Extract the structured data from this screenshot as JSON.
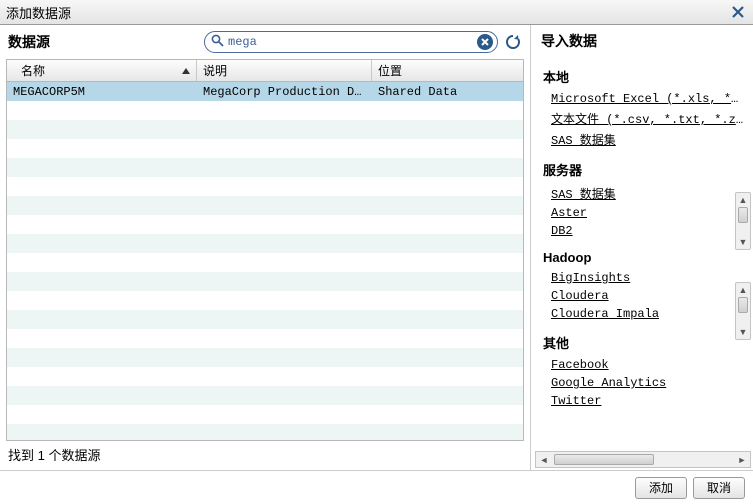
{
  "title": "添加数据源",
  "left": {
    "heading": "数据源",
    "search": {
      "value": "mega"
    },
    "columns": {
      "name": "名称",
      "desc": "说明",
      "loc": "位置"
    },
    "rows": [
      {
        "name": "MEGACORP5M",
        "desc": "MegaCorp Production Dat...",
        "loc": "Shared Data"
      }
    ],
    "footer": "找到 1 个数据源"
  },
  "right": {
    "heading": "导入数据",
    "sections": [
      {
        "title": "本地",
        "items": [
          "Microsoft Excel (*.xls, *.xlsx, *.",
          "文本文件 (*.csv, *.txt, *.zip)",
          "SAS 数据集"
        ],
        "scroll": false
      },
      {
        "title": "服务器",
        "items": [
          "SAS 数据集",
          "Aster",
          "DB2"
        ],
        "scroll": true
      },
      {
        "title": "Hadoop",
        "items": [
          "BigInsights",
          "Cloudera",
          "Cloudera Impala"
        ],
        "scroll": true
      },
      {
        "title": "其他",
        "items": [
          "Facebook",
          "Google Analytics",
          "Twitter"
        ],
        "scroll": false
      }
    ]
  },
  "buttons": {
    "ok": "添加",
    "cancel": "取消"
  }
}
